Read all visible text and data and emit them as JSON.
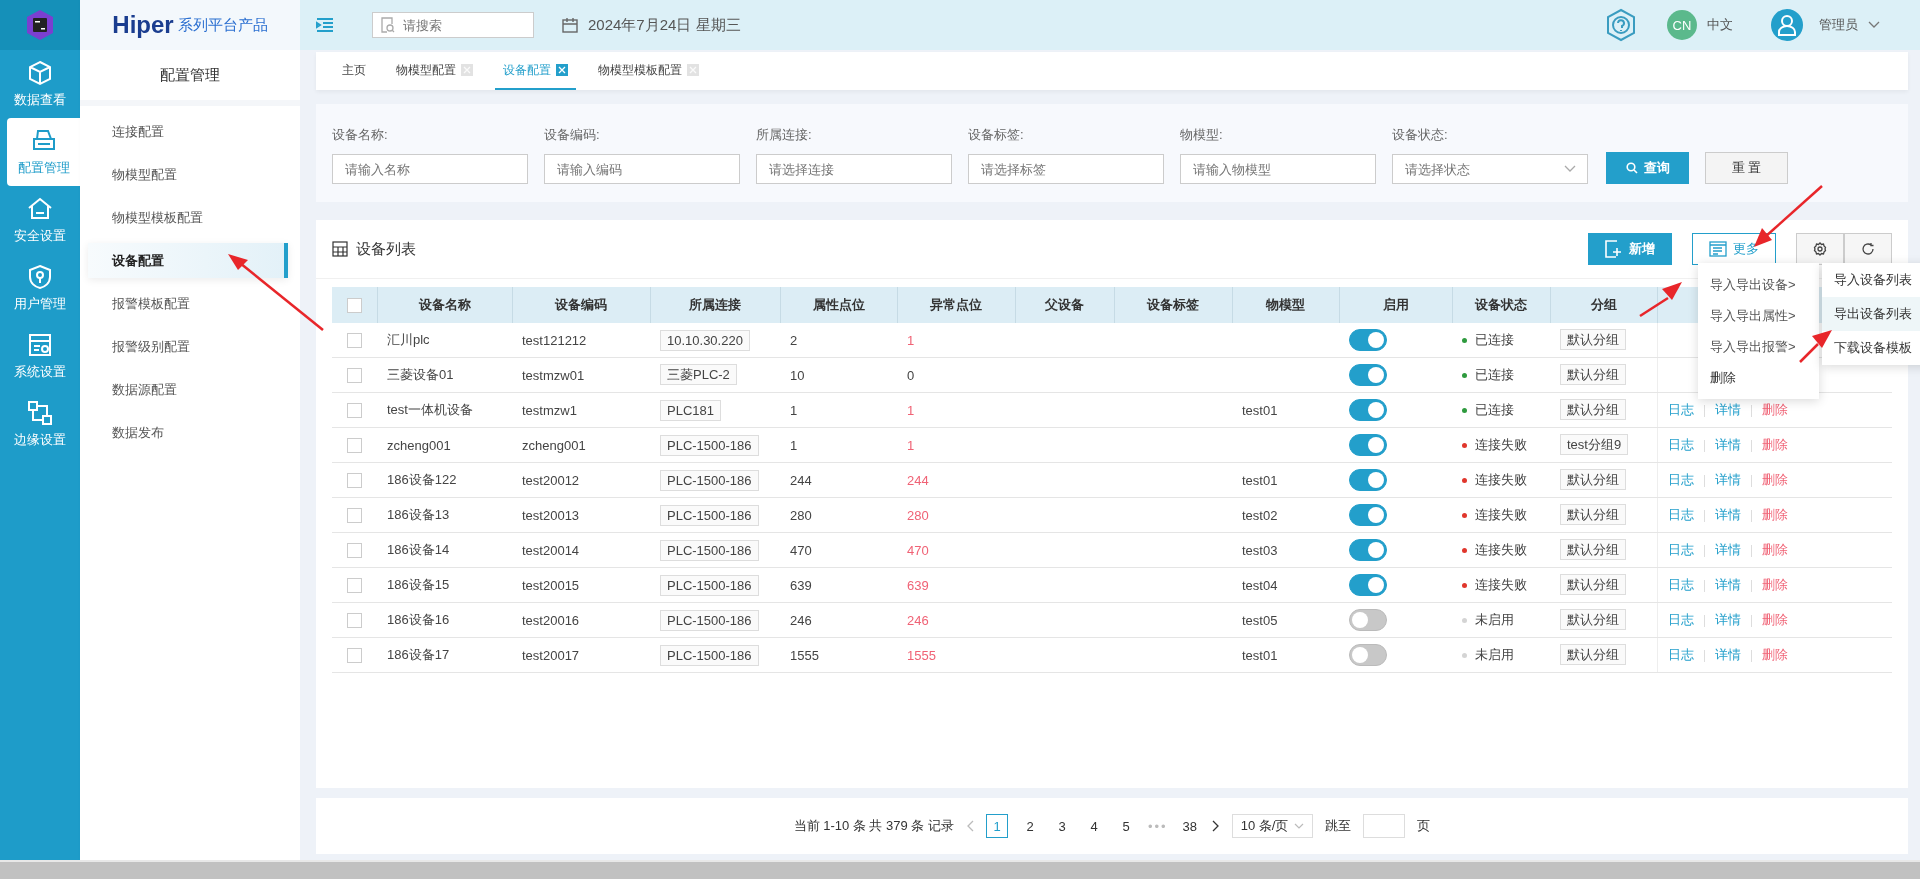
{
  "rail": {
    "items": [
      {
        "label": "数据查看",
        "selected": false
      },
      {
        "label": "配置管理",
        "selected": true
      },
      {
        "label": "安全设置",
        "selected": false
      },
      {
        "label": "用户管理",
        "selected": false
      },
      {
        "label": "系统设置",
        "selected": false
      },
      {
        "label": "边缘设置",
        "selected": false
      }
    ]
  },
  "brand": {
    "name": "Hiper",
    "tagline": "系列平台产品"
  },
  "header": {
    "search": {
      "placeholder": "请搜索"
    },
    "date": "2024年7月24日 星期三",
    "lang_badge": "CN",
    "lang": "中文",
    "user": "管理员"
  },
  "sidebar": {
    "title": "配置管理",
    "items": [
      {
        "label": "连接配置",
        "selected": false
      },
      {
        "label": "物模型配置",
        "selected": false
      },
      {
        "label": "物模型模板配置",
        "selected": false
      },
      {
        "label": "设备配置",
        "selected": true
      },
      {
        "label": "报警模板配置",
        "selected": false
      },
      {
        "label": "报警级别配置",
        "selected": false
      },
      {
        "label": "数据源配置",
        "selected": false
      },
      {
        "label": "数据发布",
        "selected": false
      }
    ]
  },
  "tabs": [
    {
      "label": "主页",
      "selected": false,
      "closable": false
    },
    {
      "label": "物模型配置",
      "selected": false,
      "closable": true
    },
    {
      "label": "设备配置",
      "selected": true,
      "closable": true
    },
    {
      "label": "物模型模板配置",
      "selected": false,
      "closable": true
    }
  ],
  "filters": {
    "fields": [
      {
        "label": "设备名称:",
        "placeholder": "请输入名称",
        "kind": "input"
      },
      {
        "label": "设备编码:",
        "placeholder": "请输入编码",
        "kind": "input"
      },
      {
        "label": "所属连接:",
        "placeholder": "请选择连接",
        "kind": "input"
      },
      {
        "label": "设备标签:",
        "placeholder": "请选择标签",
        "kind": "input"
      },
      {
        "label": "物模型:",
        "placeholder": "请输入物模型",
        "kind": "input"
      },
      {
        "label": "设备状态:",
        "placeholder": "请选择状态",
        "kind": "select"
      }
    ],
    "query": "查询",
    "reset": "重 置"
  },
  "table": {
    "title": "设备列表",
    "add": "新增",
    "more": "更多",
    "all_checked": false,
    "columns": [
      "设备名称",
      "设备编码",
      "所属连接",
      "属性点位",
      "异常点位",
      "父设备",
      "设备标签",
      "物模型",
      "启用",
      "设备状态",
      "分组"
    ],
    "rows": [
      {
        "checked": false,
        "name": "汇川plc",
        "code": "test121212",
        "connection": "10.10.30.220",
        "points": "2",
        "abnormal": "1",
        "alarm": true,
        "enabled": true,
        "status": "已连接",
        "color": "#2e9a3e",
        "group": "默认分组"
      },
      {
        "checked": false,
        "name": "三菱设备01",
        "code": "testmzw01",
        "connection": "三菱PLC-2",
        "points": "10",
        "abnormal": "0",
        "alarm": false,
        "enabled": true,
        "status": "已连接",
        "color": "#2e9a3e",
        "group": "默认分组"
      },
      {
        "checked": false,
        "name": "test一体机设备",
        "code": "testmzw1",
        "connection": "PLC181",
        "points": "1",
        "abnormal": "1",
        "alarm": true,
        "model": "test01",
        "enabled": true,
        "status": "已连接",
        "color": "#2e9a3e",
        "group": "默认分组",
        "actions": [
          {
            "label": "日志",
            "kind": "link"
          },
          {
            "label": "详情",
            "kind": "link"
          },
          {
            "label": "删除",
            "kind": "danger"
          }
        ]
      },
      {
        "checked": false,
        "name": "zcheng001",
        "code": "zcheng001",
        "connection": "PLC-1500-186",
        "points": "1",
        "abnormal": "1",
        "alarm": true,
        "enabled": true,
        "status": "连接失败",
        "color": "#e0362c",
        "group": "test分组9",
        "actions": [
          {
            "label": "日志",
            "kind": "link"
          },
          {
            "label": "详情",
            "kind": "link"
          },
          {
            "label": "删除",
            "kind": "danger"
          }
        ]
      },
      {
        "checked": false,
        "name": "186设备122",
        "code": "test20012",
        "connection": "PLC-1500-186",
        "points": "244",
        "abnormal": "244",
        "alarm": true,
        "model": "test01",
        "enabled": true,
        "status": "连接失败",
        "color": "#e0362c",
        "group": "默认分组",
        "actions": [
          {
            "label": "日志",
            "kind": "link"
          },
          {
            "label": "详情",
            "kind": "link"
          },
          {
            "label": "删除",
            "kind": "danger"
          }
        ]
      },
      {
        "checked": false,
        "name": "186设备13",
        "code": "test20013",
        "connection": "PLC-1500-186",
        "points": "280",
        "abnormal": "280",
        "alarm": true,
        "model": "test02",
        "enabled": true,
        "status": "连接失败",
        "color": "#e0362c",
        "group": "默认分组",
        "actions": [
          {
            "label": "日志",
            "kind": "link"
          },
          {
            "label": "详情",
            "kind": "link"
          },
          {
            "label": "删除",
            "kind": "danger"
          }
        ]
      },
      {
        "checked": false,
        "name": "186设备14",
        "code": "test20014",
        "connection": "PLC-1500-186",
        "points": "470",
        "abnormal": "470",
        "alarm": true,
        "model": "test03",
        "enabled": true,
        "status": "连接失败",
        "color": "#e0362c",
        "group": "默认分组",
        "actions": [
          {
            "label": "日志",
            "kind": "link"
          },
          {
            "label": "详情",
            "kind": "link"
          },
          {
            "label": "删除",
            "kind": "danger"
          }
        ]
      },
      {
        "checked": false,
        "name": "186设备15",
        "code": "test20015",
        "connection": "PLC-1500-186",
        "points": "639",
        "abnormal": "639",
        "alarm": true,
        "model": "test04",
        "enabled": true,
        "status": "连接失败",
        "color": "#e0362c",
        "group": "默认分组",
        "actions": [
          {
            "label": "日志",
            "kind": "link"
          },
          {
            "label": "详情",
            "kind": "link"
          },
          {
            "label": "删除",
            "kind": "danger"
          }
        ]
      },
      {
        "checked": false,
        "name": "186设备16",
        "code": "test20016",
        "connection": "PLC-1500-186",
        "points": "246",
        "abnormal": "246",
        "alarm": true,
        "model": "test05",
        "enabled": false,
        "status": "未启用",
        "color": "#d4d4d4",
        "group": "默认分组",
        "actions": [
          {
            "label": "日志",
            "kind": "link"
          },
          {
            "label": "详情",
            "kind": "link"
          },
          {
            "label": "删除",
            "kind": "danger"
          }
        ]
      },
      {
        "checked": false,
        "name": "186设备17",
        "code": "test20017",
        "connection": "PLC-1500-186",
        "points": "1555",
        "abnormal": "1555",
        "alarm": true,
        "model": "test01",
        "enabled": false,
        "status": "未启用",
        "color": "#d4d4d4",
        "group": "默认分组",
        "actions": [
          {
            "label": "日志",
            "kind": "link"
          },
          {
            "label": "详情",
            "kind": "link"
          },
          {
            "label": "删除",
            "kind": "danger"
          }
        ]
      }
    ]
  },
  "more_menu": {
    "items": [
      {
        "label": "导入导出设备>",
        "kind": "sub"
      },
      {
        "label": "导入导出属性>",
        "kind": "sub"
      },
      {
        "label": "导入导出报警>",
        "kind": "sub"
      },
      {
        "label": "删除",
        "kind": "danger"
      }
    ],
    "submenu": [
      {
        "label": "导入设备列表",
        "selected": false
      },
      {
        "label": "导出设备列表",
        "selected": true
      },
      {
        "label": "下载设备模板",
        "selected": false
      }
    ]
  },
  "pagination": {
    "summary": "当前 1-10 条 共 379 条 记录",
    "pages": [
      {
        "label": "1",
        "selected": true
      },
      {
        "label": "2",
        "selected": false
      },
      {
        "label": "3",
        "selected": false
      },
      {
        "label": "4",
        "selected": false
      },
      {
        "label": "5",
        "selected": false
      }
    ],
    "ellipsis": "•••",
    "last": "38",
    "page_size": "10 条/页",
    "jump": "跳至",
    "unit": "页"
  }
}
